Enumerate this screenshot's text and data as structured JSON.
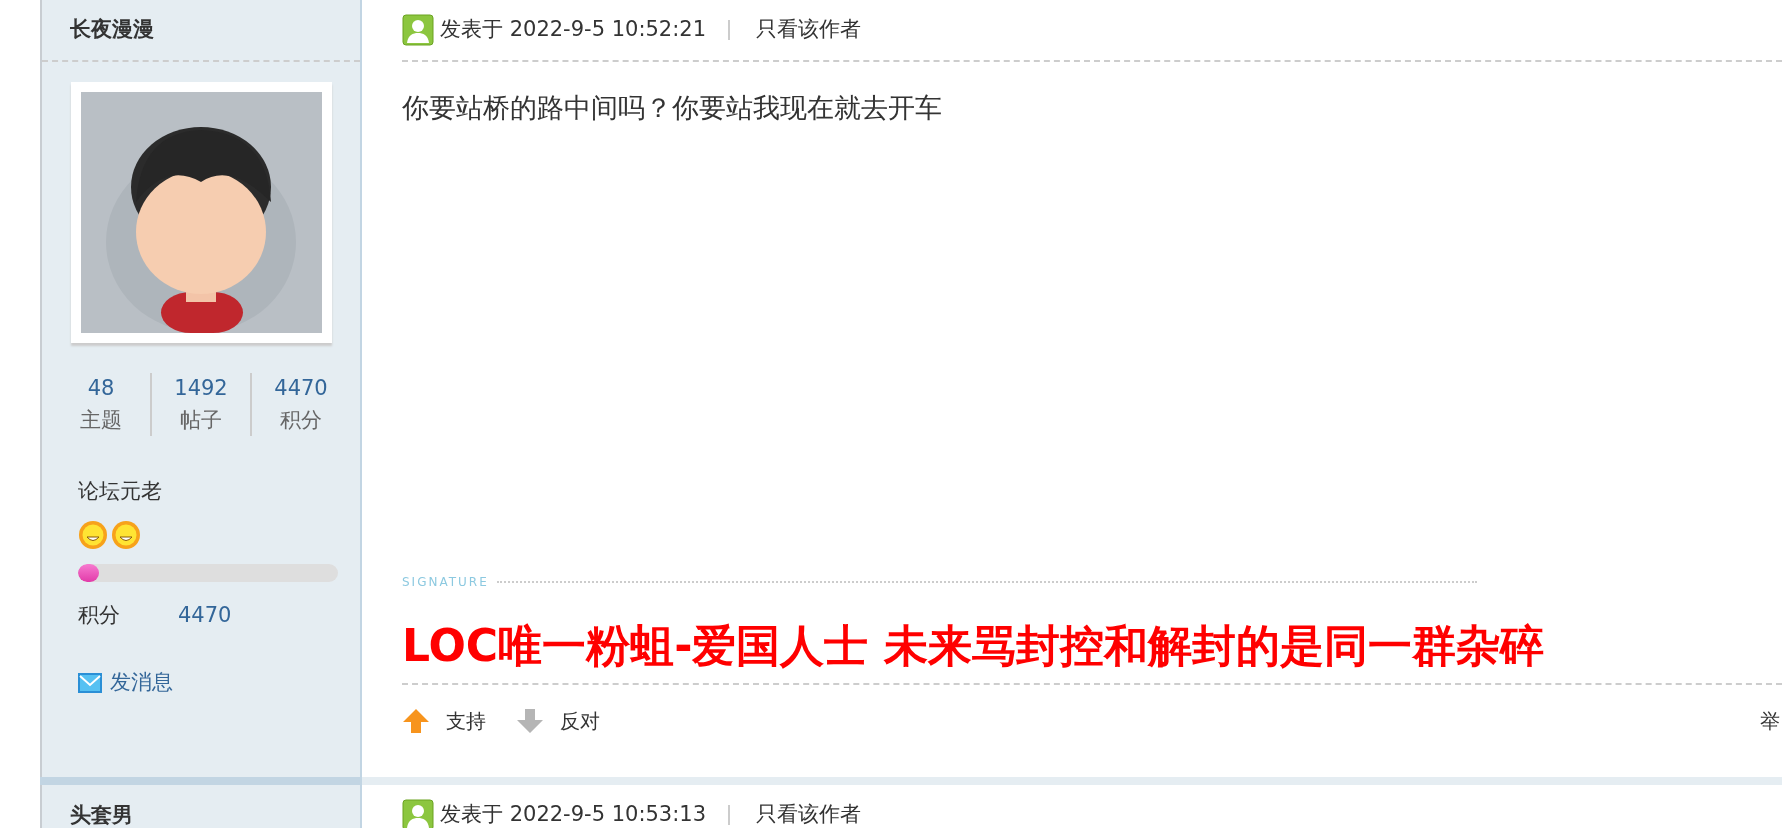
{
  "posts": [
    {
      "author": "长夜漫漫",
      "avatar": {
        "kind": "picture"
      },
      "stats": [
        {
          "value": "48",
          "label": "主题"
        },
        {
          "value": "1492",
          "label": "帖子"
        },
        {
          "value": "4470",
          "label": "积分"
        }
      ],
      "rank": "论坛元老",
      "rank_icons": [
        {
          "kind": "sun"
        },
        {
          "kind": "sun"
        }
      ],
      "level": 0.08,
      "points_label": "积分",
      "points": "4470",
      "message_link": "发消息",
      "post_time": "发表于 2022-9-5 10:52:21",
      "author_only": "只看该作者",
      "content": "你要站桥的路中间吗？你要站我现在就去开车",
      "signature_label": "SIGNATURE",
      "signature": "LOC唯一粉蛆-爱国人士 未来骂封控和解封的是同一群杂碎",
      "actions": [
        {
          "kind": "up",
          "label": "支持"
        },
        {
          "kind": "down",
          "label": "反对"
        }
      ],
      "report": "举"
    },
    {
      "author": "头套男",
      "post_time": "发表于 2022-9-5 10:53:13",
      "author_only": "只看该作者"
    }
  ]
}
